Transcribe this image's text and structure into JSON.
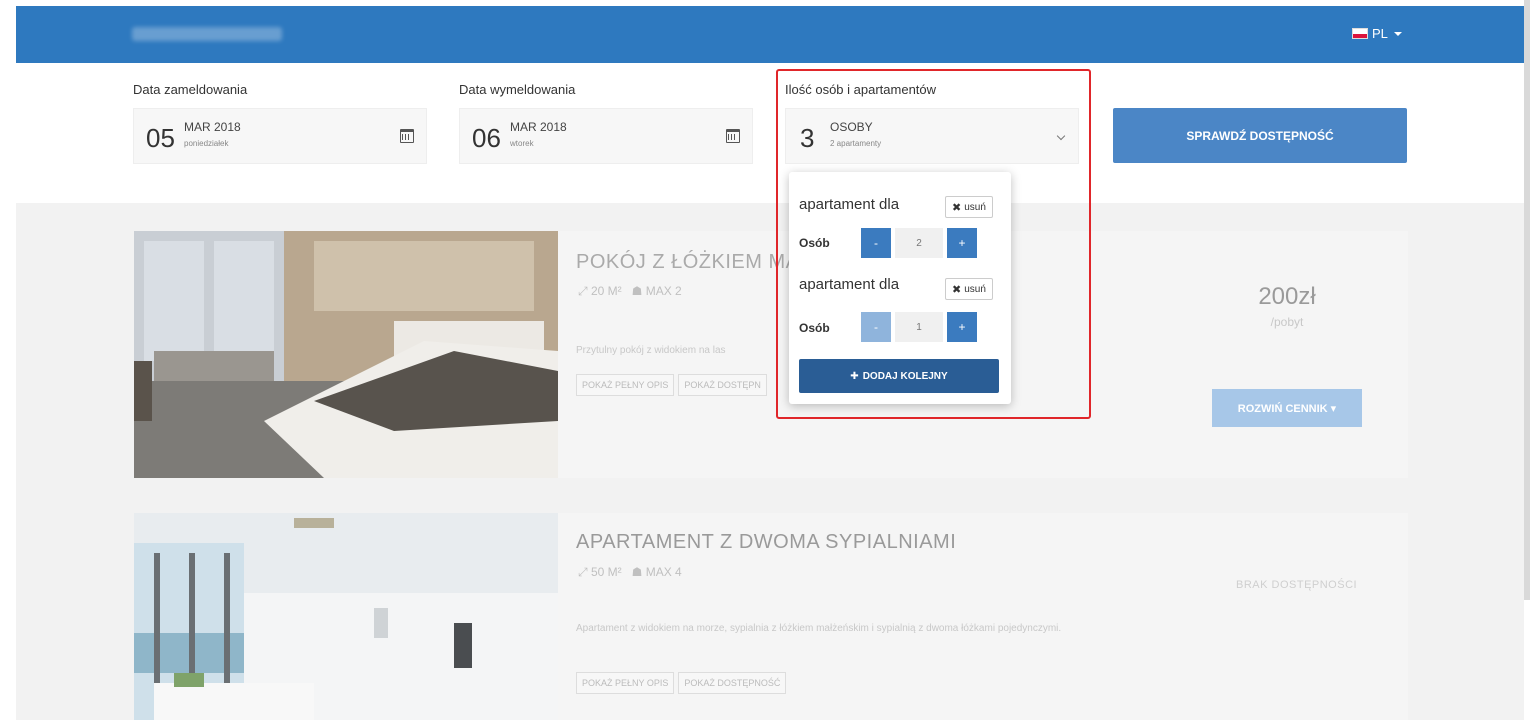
{
  "header": {
    "brand_hidden": "",
    "language": "PL"
  },
  "search": {
    "checkin": {
      "label": "Data zameldowania",
      "day": "05",
      "month": "MAR 2018",
      "weekday": "poniedziałek"
    },
    "checkout": {
      "label": "Data wymeldowania",
      "day": "06",
      "month": "MAR 2018",
      "weekday": "wtorek"
    },
    "guests": {
      "label": "Ilość osób i apartamentów",
      "count": "3",
      "unit": "OSOBY",
      "apartments": "2 apartamenty"
    },
    "check_button": "SPRAWDŹ DOSTĘPNOŚĆ"
  },
  "dropdown": {
    "apartments": [
      {
        "label": "apartament dla",
        "remove": "usuń",
        "persons_label": "Osób",
        "minus": "-",
        "value": "2",
        "plus": "+"
      },
      {
        "label": "apartament dla",
        "remove": "usuń",
        "persons_label": "Osób",
        "minus": "-",
        "value": "1",
        "plus": "+"
      }
    ],
    "add_button": "DODAJ KOLEJNY"
  },
  "rooms": [
    {
      "title": "POKÓJ Z ŁÓŻKIEM MA",
      "area": "20 M²",
      "max": "MAX 2",
      "description": "Przytulny pokój z widokiem na las",
      "full_desc_link": "POKAŻ PEŁNY OPIS",
      "availability_link": "POKAŻ DOSTĘPN",
      "price": "200zł",
      "price_unit": "/pobyt",
      "expand_button": "ROZWIŃ CENNIK ▾"
    },
    {
      "title": "APARTAMENT Z DWOMA SYPIALNIAMI",
      "area": "50 M²",
      "max": "MAX 4",
      "description": "Apartament z widokiem na morze, sypialnia z łóżkiem małżeńskim i sypialnią z dwoma łóżkami pojedynczymi.",
      "full_desc_link": "POKAŻ PEŁNY OPIS",
      "availability_link": "POKAŻ DOSTĘPNOŚĆ",
      "no_availability": "BRAK DOSTĘPNOŚCI"
    }
  ],
  "colors": {
    "primary": "#2e79bf",
    "button": "#4b86c6",
    "add_button": "#2a5d95",
    "highlight": "#e0262a"
  }
}
